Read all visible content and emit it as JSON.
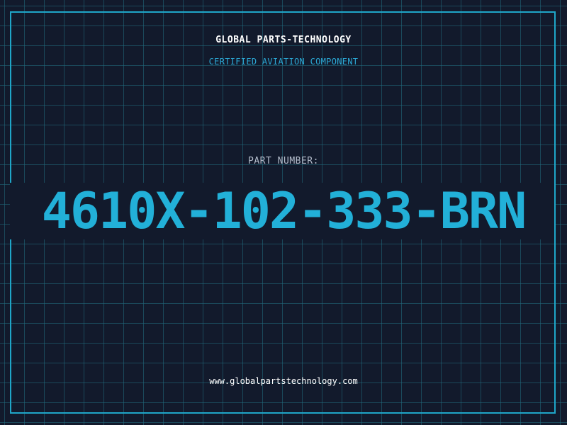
{
  "brand": {
    "title": "GLOBAL PARTS-TECHNOLOGY",
    "subtitle": "CERTIFIED AVIATION COMPONENT"
  },
  "part": {
    "label": "PART NUMBER:",
    "number": "4610X-102-333-BRN"
  },
  "footer": {
    "website": "www.globalpartstechnology.com"
  },
  "colors": {
    "background": "#121a2c",
    "grid": "#226e80",
    "frame": "#1fa6c8",
    "accent": "#22b0d8",
    "label": "#b3bccb",
    "title": "#ffffff"
  }
}
